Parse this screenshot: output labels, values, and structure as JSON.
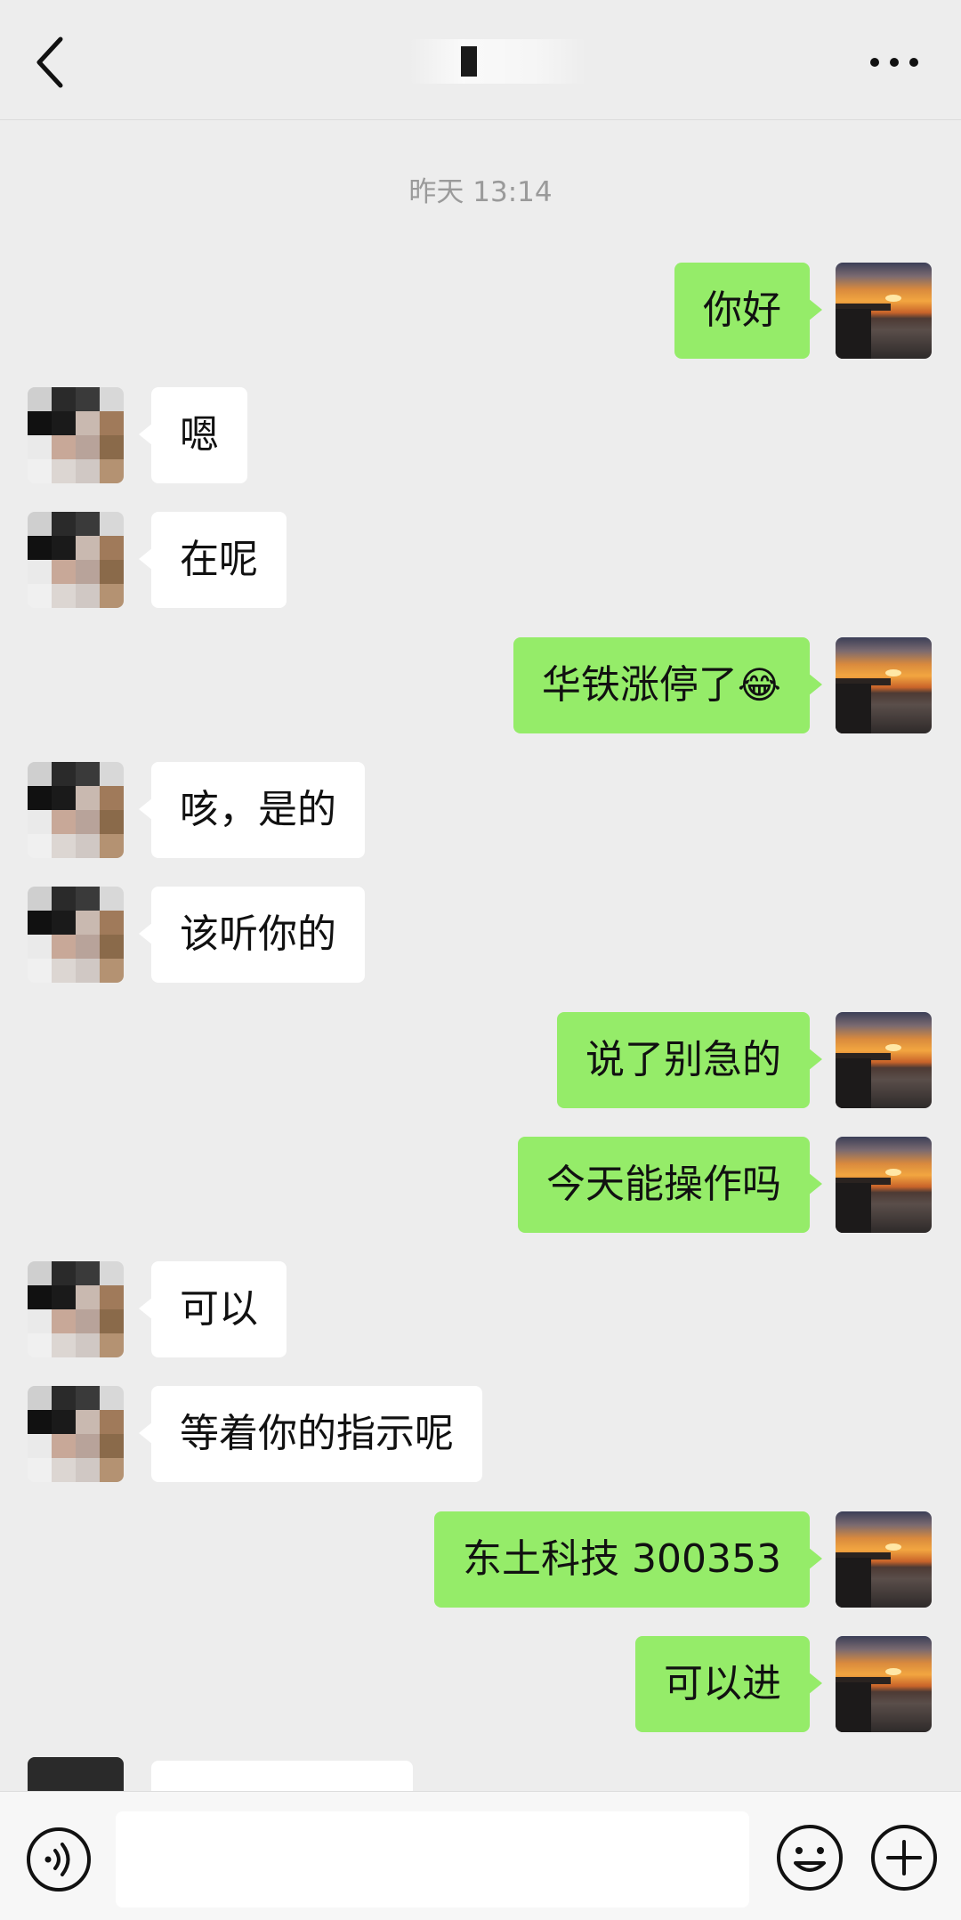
{
  "header": {
    "title": "",
    "back_icon": "chevron-left-icon",
    "more_icon": "more-horizontal-icon"
  },
  "timestamp": "昨天 13:14",
  "messages": [
    {
      "side": "right",
      "text": "你好"
    },
    {
      "side": "left",
      "text": "嗯"
    },
    {
      "side": "left",
      "text": "在呢"
    },
    {
      "side": "right",
      "text": "华铁涨停了",
      "emoji": "😂"
    },
    {
      "side": "left",
      "text": "咳，是的"
    },
    {
      "side": "left",
      "text": "该听你的"
    },
    {
      "side": "right",
      "text": "说了别急的"
    },
    {
      "side": "right",
      "text": "今天能操作吗"
    },
    {
      "side": "left",
      "text": "可以"
    },
    {
      "side": "left",
      "text": "等着你的指示呢"
    },
    {
      "side": "right",
      "text": "东土科技 300353"
    },
    {
      "side": "right",
      "text": "可以进"
    }
  ],
  "bottom_bar": {
    "voice_icon": "voice-icon",
    "input_value": "",
    "emoji_icon": "emoji-icon",
    "plus_icon": "plus-circle-icon"
  },
  "colors": {
    "sent_bubble": "#95ec69",
    "received_bubble": "#ffffff",
    "background": "#ededed"
  }
}
